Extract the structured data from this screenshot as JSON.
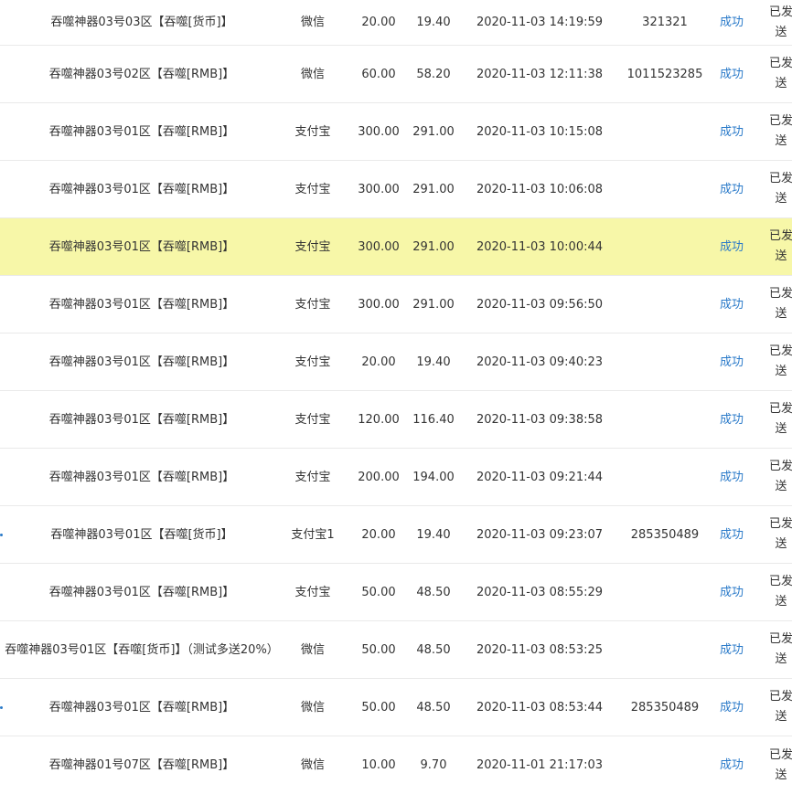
{
  "orders": [
    {
      "product": "吞噬神器03号03区【吞噬[货币]】",
      "pay": "微信",
      "amount": "20.00",
      "actual": "19.40",
      "time": "2020-11-03 14:19:59",
      "ref": "321321",
      "status": "成功",
      "delivery": "已发送"
    },
    {
      "product": "吞噬神器03号02区【吞噬[RMB]】",
      "pay": "微信",
      "amount": "60.00",
      "actual": "58.20",
      "time": "2020-11-03 12:11:38",
      "ref": "1011523285",
      "status": "成功",
      "delivery": "已发送"
    },
    {
      "product": "吞噬神器03号01区【吞噬[RMB]】",
      "pay": "支付宝",
      "amount": "300.00",
      "actual": "291.00",
      "time": "2020-11-03 10:15:08",
      "ref": "",
      "status": "成功",
      "delivery": "已发送"
    },
    {
      "product": "吞噬神器03号01区【吞噬[RMB]】",
      "pay": "支付宝",
      "amount": "300.00",
      "actual": "291.00",
      "time": "2020-11-03 10:06:08",
      "ref": "",
      "status": "成功",
      "delivery": "已发送"
    },
    {
      "product": "吞噬神器03号01区【吞噬[RMB]】",
      "pay": "支付宝",
      "amount": "300.00",
      "actual": "291.00",
      "time": "2020-11-03 10:00:44",
      "ref": "",
      "status": "成功",
      "delivery": "已发送",
      "highlighted": true
    },
    {
      "product": "吞噬神器03号01区【吞噬[RMB]】",
      "pay": "支付宝",
      "amount": "300.00",
      "actual": "291.00",
      "time": "2020-11-03 09:56:50",
      "ref": "",
      "status": "成功",
      "delivery": "已发送"
    },
    {
      "product": "吞噬神器03号01区【吞噬[RMB]】",
      "pay": "支付宝",
      "amount": "20.00",
      "actual": "19.40",
      "time": "2020-11-03 09:40:23",
      "ref": "",
      "status": "成功",
      "delivery": "已发送"
    },
    {
      "product": "吞噬神器03号01区【吞噬[RMB]】",
      "pay": "支付宝",
      "amount": "120.00",
      "actual": "116.40",
      "time": "2020-11-03 09:38:58",
      "ref": "",
      "status": "成功",
      "delivery": "已发送"
    },
    {
      "product": "吞噬神器03号01区【吞噬[RMB]】",
      "pay": "支付宝",
      "amount": "200.00",
      "actual": "194.00",
      "time": "2020-11-03 09:21:44",
      "ref": "",
      "status": "成功",
      "delivery": "已发送"
    },
    {
      "product": "吞噬神器03号01区【吞噬[货币]】",
      "pay": "支付宝1",
      "amount": "20.00",
      "actual": "19.40",
      "time": "2020-11-03 09:23:07",
      "ref": "285350489",
      "status": "成功",
      "delivery": "已发送"
    },
    {
      "product": "吞噬神器03号01区【吞噬[RMB]】",
      "pay": "支付宝",
      "amount": "50.00",
      "actual": "48.50",
      "time": "2020-11-03 08:55:29",
      "ref": "",
      "status": "成功",
      "delivery": "已发送"
    },
    {
      "product": "吞噬神器03号01区【吞噬[货币]】（测试多送20%）",
      "pay": "微信",
      "amount": "50.00",
      "actual": "48.50",
      "time": "2020-11-03 08:53:25",
      "ref": "",
      "status": "成功",
      "delivery": "已发送"
    },
    {
      "product": "吞噬神器03号01区【吞噬[RMB]】",
      "pay": "微信",
      "amount": "50.00",
      "actual": "48.50",
      "time": "2020-11-03 08:53:44",
      "ref": "285350489",
      "status": "成功",
      "delivery": "已发送"
    },
    {
      "product": "吞噬神器01号07区【吞噬[RMB]】",
      "pay": "微信",
      "amount": "10.00",
      "actual": "9.70",
      "time": "2020-11-01 21:17:03",
      "ref": "",
      "status": "成功",
      "delivery": "已发送"
    }
  ],
  "colors": {
    "status_link": "#2a7ac9",
    "highlight_row": "#f7f7a8",
    "row_border": "#e9e9e9",
    "text": "#333333"
  }
}
